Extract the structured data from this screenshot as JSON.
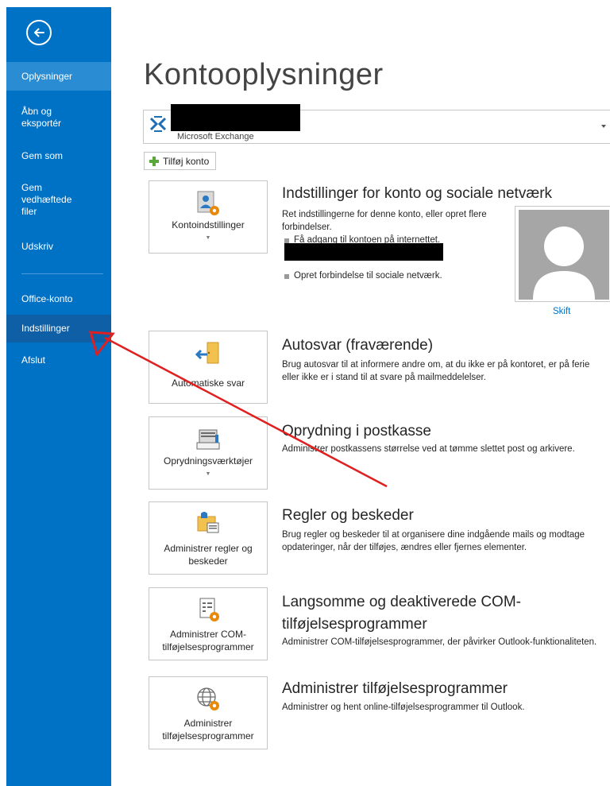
{
  "sidebar": {
    "back_icon": "back-arrow-icon",
    "items": [
      {
        "label": "Oplysninger"
      },
      {
        "label": "Åbn og eksportér"
      },
      {
        "label": "Gem som"
      },
      {
        "label": "Gem vedhæftede filer"
      },
      {
        "label": "Udskriv"
      },
      {
        "label": "Office-konto"
      },
      {
        "label": "Indstillinger"
      },
      {
        "label": "Afslut"
      }
    ],
    "active_index": 0,
    "hover_index": 6,
    "color": "#0072c6"
  },
  "main": {
    "title": "Kontooplysninger",
    "account": {
      "type": "Microsoft Exchange"
    },
    "add_account_label": "Tilføj konto",
    "sections": [
      {
        "tile_label": "Kontoindstillinger",
        "tile_icon": "account-settings-icon",
        "title": "Indstillinger for konto og sociale netværk",
        "description": "Ret indstillingerne for denne konto, eller opret flere forbindelser.",
        "bullets": [
          "Få adgang til kontoen på internettet.",
          "Opret forbindelse til sociale netværk."
        ],
        "change_photo_label": "Skift"
      },
      {
        "tile_label": "Automatiske svar",
        "tile_icon": "automatic-replies-icon",
        "title": "Autosvar (fraværende)",
        "description": "Brug autosvar til at informere andre om, at du ikke er på kontoret, er på ferie eller ikke er i stand til at svare på mailmeddelelser."
      },
      {
        "tile_label": "Oprydningsværktøjer",
        "tile_icon": "cleanup-tools-icon",
        "title": "Oprydning i postkasse",
        "description": "Administrer postkassens størrelse ved at tømme slettet post og arkivere."
      },
      {
        "tile_label": "Administrer regler og beskeder",
        "tile_icon": "rules-alerts-icon",
        "title": "Regler og beskeder",
        "description": "Brug regler og beskeder til at organisere dine indgående mails og modtage opdateringer, når der tilføjes, ændres eller fjernes elementer."
      },
      {
        "tile_label": "Administrer COM-tilføjelsesprogrammer",
        "tile_icon": "com-addins-icon",
        "title": "Langsomme og deaktiverede COM-tilføjelsesprogrammer",
        "description": "Administrer COM-tilføjelsesprogrammer, der påvirker Outlook-funktionaliteten."
      },
      {
        "tile_label": "Administrer tilføjelsesprogrammer",
        "tile_icon": "manage-addins-icon",
        "title": "Administrer tilføjelsesprogrammer",
        "description": "Administrer og hent online-tilføjelsesprogrammer til Outlook."
      }
    ]
  },
  "annotation": {
    "color": "#e02020",
    "icon": "red-arrow-annotation"
  }
}
